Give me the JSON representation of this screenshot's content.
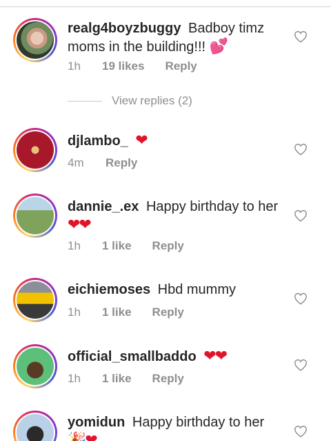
{
  "comments": [
    {
      "username": "realg4boyzbuggy",
      "text": "Badboy timz moms in the building!!!",
      "emoji": "💕",
      "time": "1h",
      "likes": "19 likes",
      "reply": "Reply",
      "view_replies": "View replies (2)"
    },
    {
      "username": "djlambo_",
      "text": "",
      "emoji": "❤",
      "time": "4m",
      "likes": "",
      "reply": "Reply"
    },
    {
      "username": "dannie_.ex",
      "text": "Happy birthday to her",
      "emoji": "❤❤",
      "time": "1h",
      "likes": "1 like",
      "reply": "Reply"
    },
    {
      "username": "eichiemoses",
      "text": "Hbd mummy",
      "time": "1h",
      "likes": "1 like",
      "reply": "Reply"
    },
    {
      "username": "official_smallbaddo",
      "text": "",
      "emoji": "❤❤",
      "time": "1h",
      "likes": "1 like",
      "reply": "Reply"
    },
    {
      "username": "yomidun",
      "text": "Happy birthday to her",
      "emoji": "🎉❤",
      "time": "",
      "likes": "",
      "reply": ""
    }
  ],
  "colors": {
    "username": "#262626",
    "meta": "#8e8e8e",
    "heart_red": "#e0142a",
    "divider": "#dbdbdb"
  },
  "icons": {
    "like": "heart-outline-icon"
  }
}
